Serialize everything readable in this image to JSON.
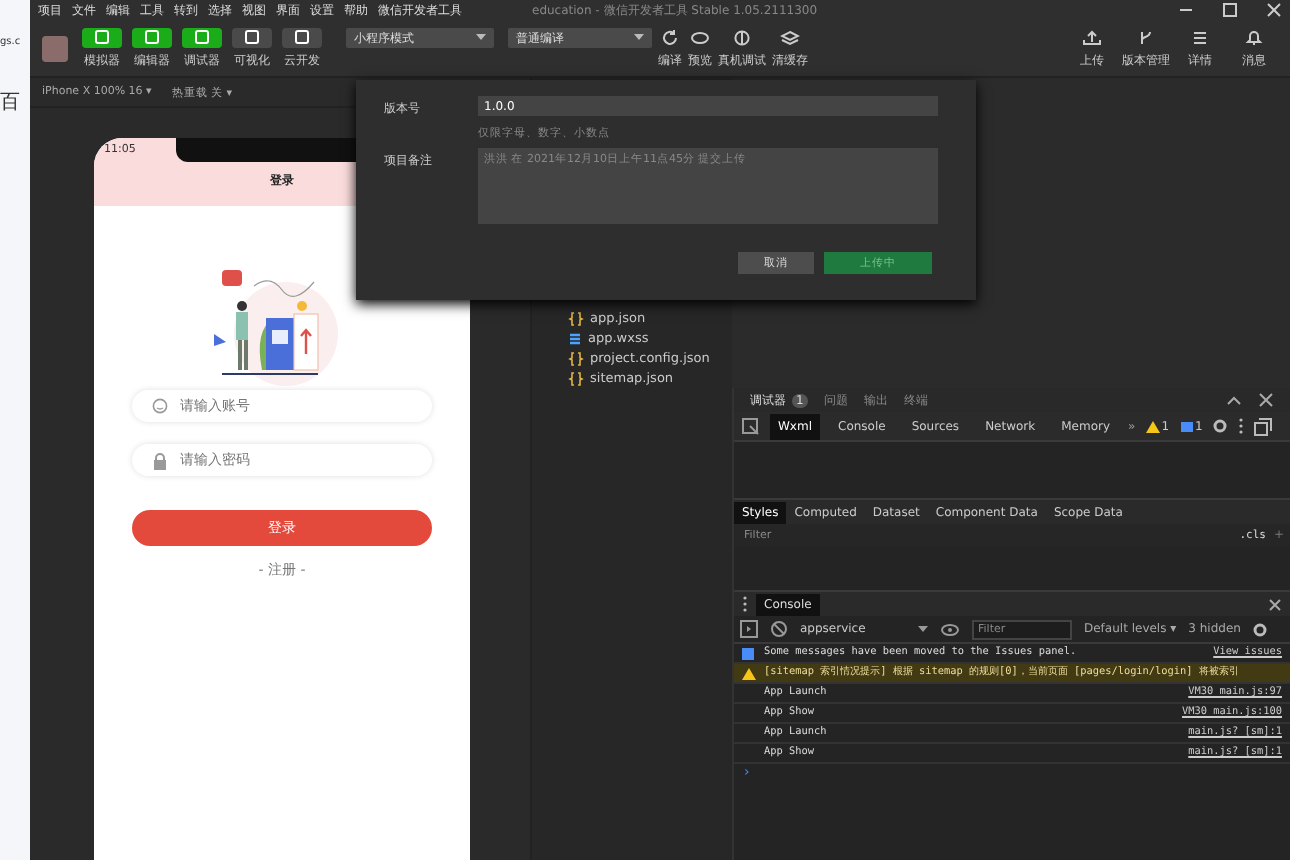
{
  "browser_strip": {
    "url_fragment": "gs.c",
    "bookmark": "百"
  },
  "menu_bar": {
    "items": [
      "项目",
      "文件",
      "编辑",
      "工具",
      "转到",
      "选择",
      "视图",
      "界面",
      "设置",
      "帮助",
      "微信开发者工具"
    ],
    "title": "education - 微信开发者工具 Stable 1.05.2111300"
  },
  "toolbar": {
    "view_buttons": [
      {
        "label": "模拟器",
        "selected": true
      },
      {
        "label": "编辑器",
        "selected": true
      },
      {
        "label": "调试器",
        "selected": true
      },
      {
        "label": "可视化",
        "selected": false
      },
      {
        "label": "云开发",
        "selected": false
      }
    ],
    "mode_select": "小程序模式",
    "compile_select": "普通编译",
    "actions": [
      {
        "label": "编译",
        "kind": "refresh"
      },
      {
        "label": "预览",
        "kind": "eye"
      },
      {
        "label": "真机调试",
        "kind": "debug"
      },
      {
        "label": "清缓存",
        "kind": "layers"
      }
    ],
    "right_actions": [
      {
        "label": "上传",
        "kind": "upload"
      },
      {
        "label": "版本管理",
        "kind": "branch"
      },
      {
        "label": "详情",
        "kind": "menu"
      },
      {
        "label": "消息",
        "kind": "bell"
      }
    ]
  },
  "simulator_bar": {
    "device": "iPhone X 100% 16 ▾",
    "hot_reload": "热重载 关 ▾"
  },
  "phone": {
    "time": "11:05",
    "nav_title": "登录",
    "account_placeholder": "请输入账号",
    "password_placeholder": "请输入密码",
    "login_button": "登录",
    "register_link": "- 注册 -"
  },
  "upload_dialog": {
    "version_label": "版本号",
    "version_value": "1.0.0",
    "version_hint": "仅限字母、数字、小数点",
    "note_label": "项目备注",
    "note_placeholder": "洪洪 在 2021年12月10日上午11点45分 提交上传",
    "cancel": "取消",
    "submit": "上传中"
  },
  "files": [
    {
      "name": "app.json",
      "kind": "json"
    },
    {
      "name": "app.wxss",
      "kind": "wxss"
    },
    {
      "name": "project.config.json",
      "kind": "json"
    },
    {
      "name": "sitemap.json",
      "kind": "json"
    }
  ],
  "devtools": {
    "panel_tabs": [
      {
        "label": "调试器",
        "badge": "1",
        "selected": true
      },
      {
        "label": "问题",
        "selected": false
      },
      {
        "label": "输出",
        "selected": false
      },
      {
        "label": "终端",
        "selected": false
      }
    ],
    "tool_tabs": [
      {
        "label": "Wxml",
        "selected": true
      },
      {
        "label": "Console",
        "selected": false
      },
      {
        "label": "Sources",
        "selected": false
      },
      {
        "label": "Network",
        "selected": false
      },
      {
        "label": "Memory",
        "selected": false
      }
    ],
    "more": "»",
    "warnings": "1",
    "infos": "1",
    "style_tabs": [
      {
        "label": "Styles",
        "selected": true
      },
      {
        "label": "Computed",
        "selected": false
      },
      {
        "label": "Dataset",
        "selected": false
      },
      {
        "label": "Component Data",
        "selected": false
      },
      {
        "label": "Scope Data",
        "selected": false
      }
    ],
    "filter_placeholder": "Filter",
    "cls": ".cls",
    "plus": "+",
    "console": {
      "tab": "Console",
      "context": "appservice",
      "filter_placeholder": "Filter",
      "levels": "Default levels ▾",
      "hidden": "3 hidden",
      "messages": [
        {
          "kind": "info",
          "text": "Some messages have been moved to the Issues panel.",
          "link": "View issues"
        },
        {
          "kind": "warning",
          "text": "[sitemap 索引情况提示] 根据 sitemap 的规则[0]，当前页面 [pages/login/login] 将被索引"
        },
        {
          "kind": "log",
          "text": "App Launch",
          "link": "VM30 main.js:97"
        },
        {
          "kind": "log",
          "text": "App Show",
          "link": "VM30 main.js:100"
        },
        {
          "kind": "log",
          "text": "App Launch",
          "link": "main.js? [sm]:1"
        },
        {
          "kind": "log",
          "text": "App Show",
          "link": "main.js? [sm]:1"
        }
      ],
      "prompt": "›"
    }
  }
}
